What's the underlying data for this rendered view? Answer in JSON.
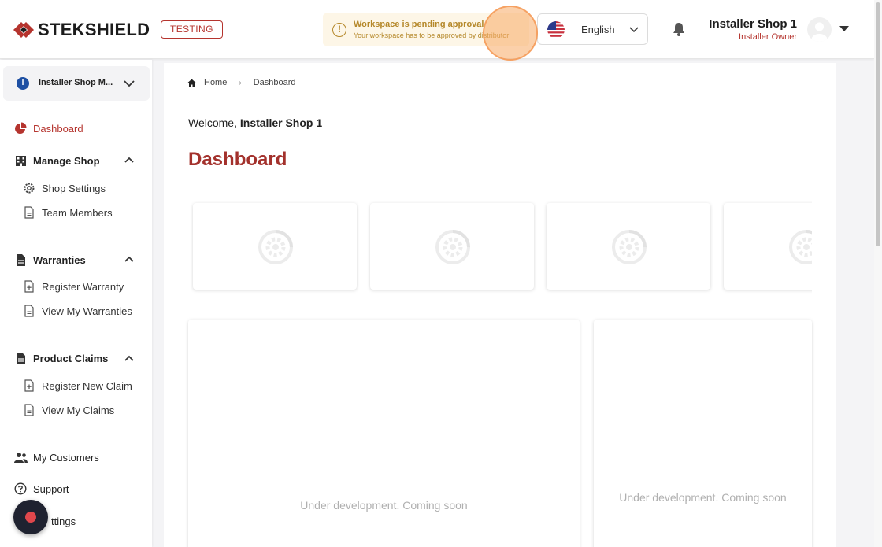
{
  "header": {
    "brand": "STEKSHIELD",
    "env_badge": "TESTING",
    "approval": {
      "title": "Workspace is pending approval",
      "message": "Your workspace has to be approved by distributor"
    },
    "language": "English",
    "user": {
      "name": "Installer Shop 1",
      "role": "Installer Owner"
    }
  },
  "sidebar": {
    "workspace": {
      "initial": "I",
      "name": "Installer Shop M..."
    },
    "dashboard": "Dashboard",
    "manage_shop": {
      "label": "Manage Shop",
      "items": [
        "Shop Settings",
        "Team Members"
      ]
    },
    "warranties": {
      "label": "Warranties",
      "items": [
        "Register Warranty",
        "View My Warranties"
      ]
    },
    "product_claims": {
      "label": "Product Claims",
      "items": [
        "Register New Claim",
        "View My Claims"
      ]
    },
    "my_customers": "My Customers",
    "support": "Support",
    "settings": "ttings"
  },
  "main": {
    "breadcrumb": [
      "Home",
      "Dashboard"
    ],
    "welcome_prefix": "Welcome,",
    "welcome_name": "Installer Shop 1",
    "title": "Dashboard",
    "panel_left_msg": "Under development. Coming soon",
    "panel_right_msg": "Under development. Coming soon"
  },
  "colors": {
    "accent": "#a3312c",
    "brand_red": "#b5342e",
    "warning": "#b5882a"
  }
}
